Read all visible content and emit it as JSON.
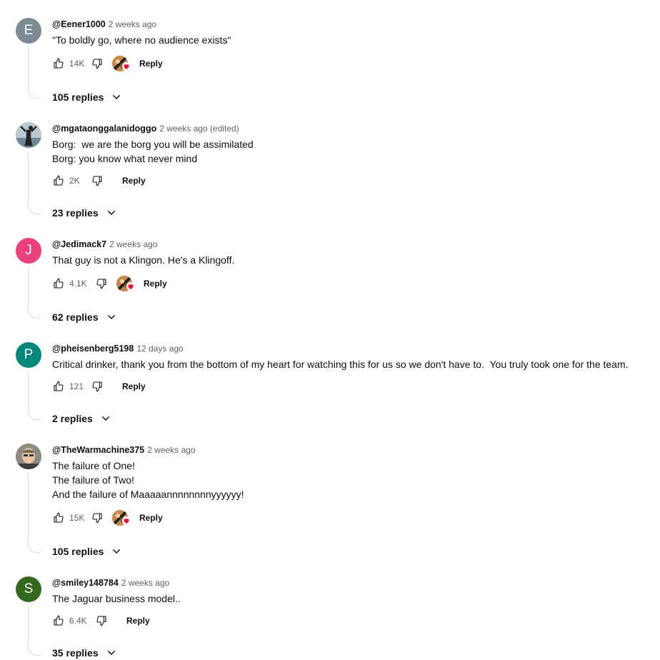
{
  "comments": [
    {
      "avatar_letter": "E",
      "avatar_color": "#7b8a93",
      "handle": "@Eener1000",
      "time": "2 weeks ago",
      "text": "\"To boldly go, where no audience exists\"",
      "likes": "14K",
      "reply_label": "Reply",
      "creator_heart": true,
      "replies_label": "105 replies"
    },
    {
      "avatar_letter": "",
      "avatar_color": "#9bb0bd",
      "handle": "@mgataonggalanidoggo",
      "time": "2 weeks ago (edited)",
      "text": "Borg:  we are the borg you will be assimilated\nBorg: you know what never mind",
      "likes": "2K",
      "reply_label": "Reply",
      "creator_heart": false,
      "replies_label": "23 replies"
    },
    {
      "avatar_letter": "J",
      "avatar_color": "#ec407a",
      "handle": "@Jedimack7",
      "time": "2 weeks ago",
      "text": "That guy is not a Klingon. He's a Klingoff.",
      "likes": "4.1K",
      "reply_label": "Reply",
      "creator_heart": true,
      "replies_label": "62 replies"
    },
    {
      "avatar_letter": "P",
      "avatar_color": "#00897b",
      "handle": "@pheisenberg5198",
      "time": "12 days ago",
      "text": "Critical drinker, thank you from the bottom of my heart for watching this for us so we don't have to.  You truly took one for the team.",
      "likes": "121",
      "reply_label": "Reply",
      "creator_heart": false,
      "replies_label": "2 replies"
    },
    {
      "avatar_letter": "",
      "avatar_color": "#a8a49c",
      "handle": "@TheWarmachine375",
      "time": "2 weeks ago",
      "text": "The failure of One!\nThe failure of Two!\nAnd the failure of Maaaaannnnnnnnyyyyyy!",
      "likes": "15K",
      "reply_label": "Reply",
      "creator_heart": true,
      "replies_label": "105 replies"
    },
    {
      "avatar_letter": "S",
      "avatar_color": "#33691e",
      "handle": "@smiley148784",
      "time": "2 weeks ago",
      "text": "The Jaguar business model..",
      "likes": "6.4K",
      "reply_label": "Reply",
      "creator_heart": false,
      "replies_label": "35 replies"
    }
  ],
  "icons": {
    "like": "thumbs-up-icon",
    "dislike": "thumbs-down-icon",
    "expand": "chevron-down-icon",
    "heart": "heart-icon"
  }
}
